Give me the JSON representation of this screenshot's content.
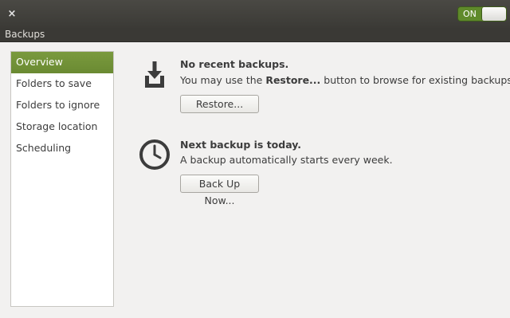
{
  "window": {
    "close_glyph": "×",
    "toggle_label": "ON"
  },
  "menubar": {
    "title": "Backups"
  },
  "sidebar": {
    "items": [
      {
        "label": "Overview",
        "active": true
      },
      {
        "label": "Folders to save"
      },
      {
        "label": "Folders to ignore"
      },
      {
        "label": "Storage location"
      },
      {
        "label": "Scheduling"
      }
    ]
  },
  "overview": {
    "recent": {
      "icon": "download-tray-icon",
      "heading": "No recent backups.",
      "desc_prefix": "You may use the ",
      "desc_bold": "Restore...",
      "desc_suffix": " button to browse for existing backups.",
      "button_label": "Restore..."
    },
    "next": {
      "icon": "clock-icon",
      "heading": "Next backup is today.",
      "desc": "A backup automatically starts every week.",
      "button_label": "Back Up Now..."
    }
  },
  "colors": {
    "accent": "#6a8a32",
    "titlebar": "#3b3a36",
    "background": "#f2f1f0"
  }
}
